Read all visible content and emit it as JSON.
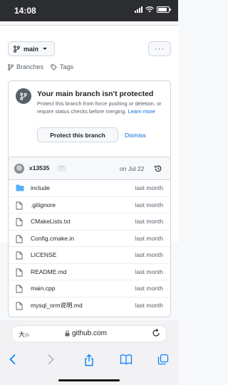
{
  "status_bar": {
    "time": "14:08"
  },
  "header": {
    "branch_label": "main",
    "more_label": "···"
  },
  "nav_links": {
    "branches": "Branches",
    "tags": "Tags"
  },
  "protection": {
    "title": "Your main branch isn't protected",
    "description": "Protect this branch from force pushing or deletion, or require status checks before merging.",
    "learn_more": "Learn more",
    "protect_button": "Protect this branch",
    "dismiss": "Dismiss"
  },
  "commit": {
    "author": "x13535",
    "ellipsis": "···",
    "date": "on Jul 22"
  },
  "files": [
    {
      "name": "include",
      "type": "folder",
      "date": "last month"
    },
    {
      "name": ".gitignore",
      "type": "file",
      "date": "last month"
    },
    {
      "name": "CMakeLists.txt",
      "type": "file",
      "date": "last month"
    },
    {
      "name": "Config.cmake.in",
      "type": "file",
      "date": "last month"
    },
    {
      "name": "LICENSE",
      "type": "file",
      "date": "last month"
    },
    {
      "name": "README.md",
      "type": "file",
      "date": "last month"
    },
    {
      "name": "main.cpp",
      "type": "file",
      "date": "last month"
    },
    {
      "name": "mysql_orm说明.md",
      "type": "file",
      "date": "last month"
    }
  ],
  "browser": {
    "text_size_label": "大小",
    "text_size_big": "大",
    "text_size_small": "小",
    "url": "github.com"
  },
  "colors": {
    "accent": "#0969da",
    "folder": "#54aeff",
    "muted": "#57606a",
    "border": "#d0d7de"
  }
}
